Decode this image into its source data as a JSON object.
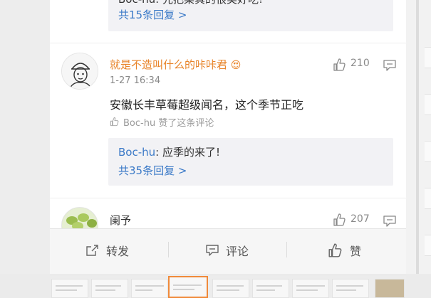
{
  "comments": [
    {
      "reply_preview_partial": "Boc-hu: 先把菜真的很美好吃!",
      "more_replies": "共15条回复 >"
    },
    {
      "username": "就是不造叫什么的咔咔君",
      "badge_emoji": "😍",
      "time": "1-27 16:34",
      "text": "安徽长丰草莓超级闻名，这个季节正吃",
      "liked_by": "Boc-hu 赞了这条评论",
      "likes": "210",
      "reply": {
        "user": "Boc-hu",
        "text": ": 应季的来了!"
      },
      "more_replies": "共35条回复 >"
    },
    {
      "username": "阑予",
      "likes": "207"
    }
  ],
  "actions": {
    "repost": "转发",
    "comment": "评论",
    "like": "赞"
  },
  "colors": {
    "username": "#e8842a",
    "link": "#3a79c7",
    "active_thumb": "#f08a3a"
  },
  "thumbnail_strip": {
    "count": 9,
    "active_index": 3
  }
}
